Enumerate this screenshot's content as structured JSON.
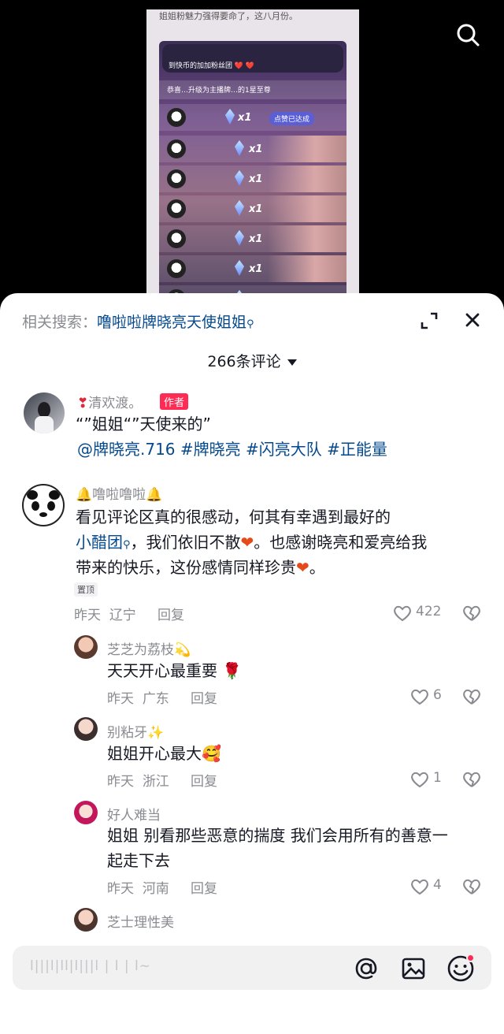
{
  "video": {
    "caption": "姐姐粉魅力强得要命了，这八月份。",
    "live_banner": "到快币的加加粉丝团 ❤️ ❤️",
    "upgrade_text": "恭喜…升级为主播牌…的1星至尊",
    "like_pill": "点赞已达成",
    "gift_multiplier": "x1"
  },
  "sheet": {
    "related_prefix": "相关搜索：",
    "related_keyword": "噜啦啦牌晓亮天使姐姐",
    "comment_count": "266条评论"
  },
  "comments": [
    {
      "name": "清欢渡。",
      "author_tag": "作者",
      "text": "“”姐姐“”天使来的”",
      "hashtags": "@牌晓亮.716 #牌晓亮 #闪亮大队 #正能量"
    },
    {
      "name": "噜啦噜啦",
      "text_1": "看见评论区真的很感动，何其有幸遇到最好的",
      "link": "小醋团",
      "text_2": "，我们依旧不散",
      "text_3": "。也感谢晓亮和爱亮给我",
      "text_4": "带来的快乐，这份感情同样珍贵",
      "pin": "置顶",
      "time": "昨天",
      "location": "辽宁",
      "reply": "回复",
      "likes": "422"
    }
  ],
  "replies": [
    {
      "name": "芝芝为荔枝",
      "text": "天天开心最重要",
      "time": "昨天",
      "location": "广东",
      "reply": "回复",
      "likes": "6"
    },
    {
      "name": "别粘牙",
      "text": "姐姐开心最大",
      "time": "昨天",
      "location": "浙江",
      "reply": "回复",
      "likes": "1"
    },
    {
      "name": "好人难当",
      "text_1": "姐姐 别看那些恶意的揣度  我们会用所有的善意一",
      "text_2": "起走下去",
      "time": "昨天",
      "location": "河南",
      "reply": "回复",
      "likes": "4"
    },
    {
      "name": "芝士理性美"
    }
  ],
  "input": {
    "placeholder": "l|||l|ll|l|||l | l | l~"
  },
  "colors": {
    "accent": "#fe2c55",
    "link": "#04498d",
    "muted": "#8a8b91"
  }
}
